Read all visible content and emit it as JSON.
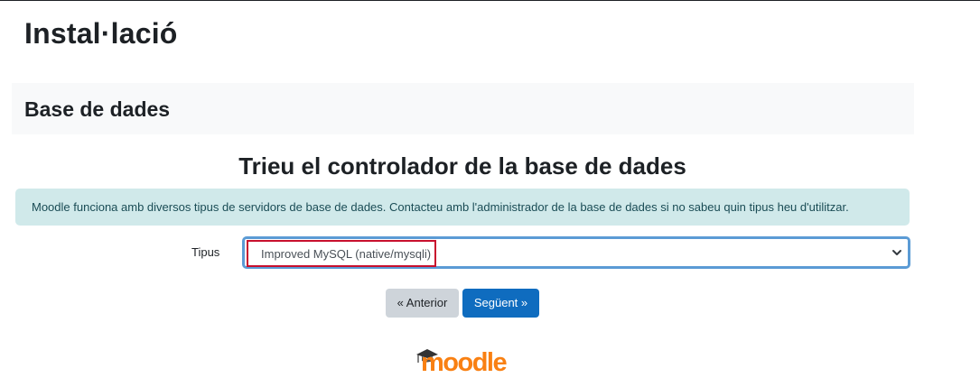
{
  "page": {
    "title": "Instal·lació"
  },
  "section": {
    "title": "Base de dades"
  },
  "main": {
    "heading": "Trieu el controlador de la base de dades",
    "info": "Moodle funciona amb diversos tipus de servidors de base de dades. Contacteu amb l'administrador de la base de dades si no sabeu quin tipus heu d'utilitzar."
  },
  "form": {
    "type_label": "Tipus",
    "type_selected": "Improved MySQL (native/mysqli)"
  },
  "buttons": {
    "previous": "« Anterior",
    "next": "Següent »"
  },
  "logo": {
    "text": "moodle",
    "icon": "graduation-cap-icon"
  },
  "colors": {
    "primary": "#0f6cbf",
    "alert_bg": "#d0e9ea",
    "alert_text": "#1a4c55",
    "logo_orange": "#f98012",
    "select_focus": "#5b9bd5",
    "highlight_red": "#c8102e"
  }
}
